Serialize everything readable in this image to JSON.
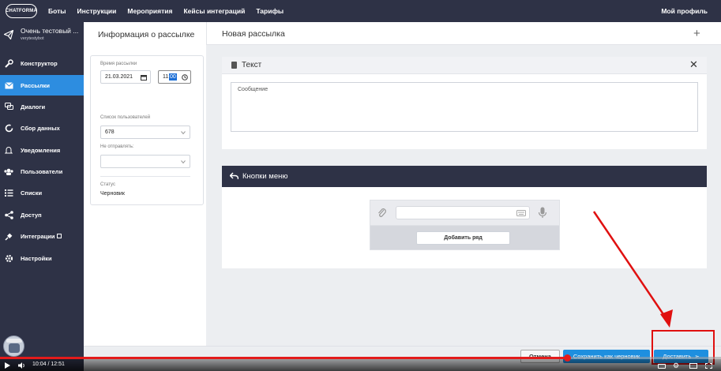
{
  "topbar": {
    "logo": "CHATFORMA",
    "nav": [
      "Боты",
      "Инструкции",
      "Мероприятия",
      "Кейсы интеграций",
      "Тарифы"
    ],
    "profile": "Мой профиль"
  },
  "bot": {
    "name": "Очень тестовый ...",
    "username": "verytestybot"
  },
  "sidebar": {
    "items": [
      {
        "label": "Конструктор",
        "icon": "wrench-icon"
      },
      {
        "label": "Рассылки",
        "icon": "envelope-icon",
        "active": true
      },
      {
        "label": "Диалоги",
        "icon": "chat-icon"
      },
      {
        "label": "Сбор данных",
        "icon": "refresh-icon"
      },
      {
        "label": "Уведомления",
        "icon": "bell-icon"
      },
      {
        "label": "Пользователи",
        "icon": "users-icon"
      },
      {
        "label": "Списки",
        "icon": "list-icon"
      },
      {
        "label": "Доступ",
        "icon": "share-icon"
      },
      {
        "label": "Интеграции",
        "icon": "plug-icon",
        "external": true
      },
      {
        "label": "Настройки",
        "icon": "gear-icon"
      }
    ]
  },
  "info": {
    "title": "Информация о рассылке",
    "time_label": "Время рассылки",
    "date_value": "21.03.2021",
    "time_hours": "11:",
    "time_minutes": "00",
    "list_label": "Список пользователей",
    "list_value": "678",
    "exclude_label": "Не отправлять:",
    "exclude_value": "",
    "status_label": "Статус",
    "status_value": "Черновик"
  },
  "main": {
    "title": "Новая рассылка",
    "text_block": {
      "title": "Текст",
      "placeholder": "Сообщение"
    },
    "menu_block": {
      "title": "Кнопки меню",
      "add_row": "Добавить ряд"
    }
  },
  "footer": {
    "cancel": "Отмена",
    "save_draft": "Сохранить как черновик",
    "deliver": "Доставить",
    "deliver_arrow": "➢"
  },
  "video": {
    "time": "10:04 / 12:51",
    "progress": 0.787
  },
  "colors": {
    "nav_bg": "#2e3246",
    "accent": "#2d8de0",
    "annotation": "#e01010"
  }
}
